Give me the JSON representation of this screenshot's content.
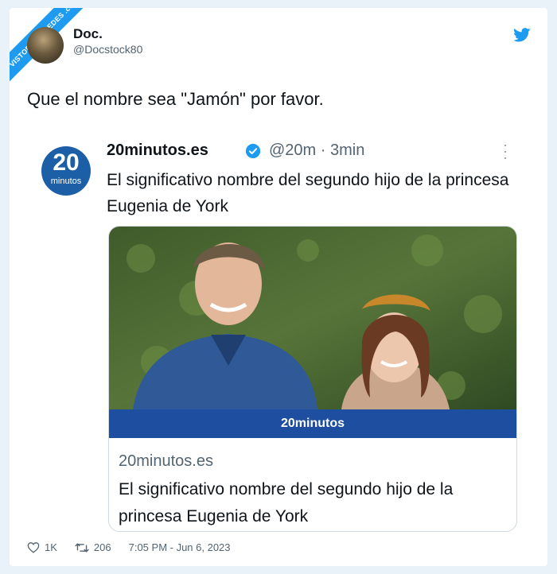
{
  "watermark": "VISTOENLASREDES .com",
  "author": {
    "name": "Doc.",
    "handle": "@Docstock80"
  },
  "tweet": {
    "text": "Que el nombre sea \"Jamón\" por favor."
  },
  "quoted": {
    "logo_number": "20",
    "logo_word": "minutos",
    "name": "20minutos.es",
    "handle_time": "@20m · 3min",
    "text": "El significativo nombre del segundo hijo de la princesa Eugenia de York",
    "media": {
      "brand": "20minutos",
      "domain": "20minutos.es",
      "title": "El significativo nombre del segundo hijo de la princesa Eugenia de York"
    }
  },
  "footer": {
    "likes": "1K",
    "retweets": "206",
    "timestamp": "7:05 PM - Jun 6, 2023"
  },
  "colors": {
    "twitter_blue": "#1d9bf0",
    "brand_blue": "#1d4ea0"
  }
}
